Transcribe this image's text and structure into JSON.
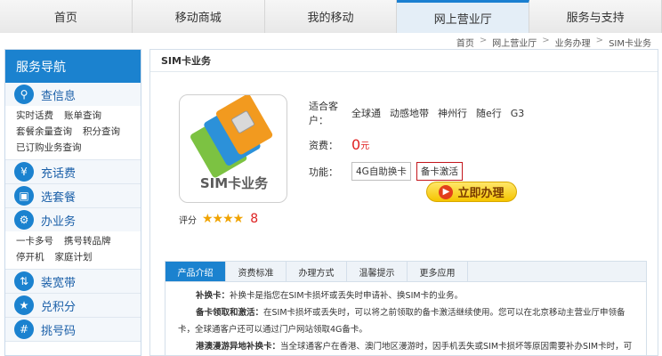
{
  "topnav": [
    "首页",
    "移动商城",
    "我的移动",
    "网上营业厅",
    "服务与支持"
  ],
  "breadcrumb": [
    "首页",
    "网上营业厅",
    "业务办理",
    "SIM卡业务"
  ],
  "sidebar": {
    "title": "服务导航",
    "sections": [
      {
        "title": "查信息",
        "icon": "search-icon",
        "links": [
          "实时话费",
          "账单查询",
          "套餐余量查询",
          "积分查询",
          "已订购业务查询"
        ]
      },
      {
        "title": "充话费",
        "icon": "recharge-icon",
        "links": []
      },
      {
        "title": "选套餐",
        "icon": "package-icon",
        "links": []
      },
      {
        "title": "办业务",
        "icon": "gear-icon",
        "links": [
          "一卡多号",
          "携号转品牌",
          "停开机",
          "家庭计划"
        ]
      },
      {
        "title": "装宽带",
        "icon": "broadband-icon",
        "links": []
      },
      {
        "title": "兑积分",
        "icon": "points-icon",
        "links": []
      },
      {
        "title": "挑号码",
        "icon": "number-icon",
        "links": []
      }
    ]
  },
  "main": {
    "title": "SIM卡业务",
    "product_image_text": "SIM卡业务",
    "rating_label": "评分",
    "rating_stars": 4,
    "rating_score": "8",
    "customers_label": "适合客户：",
    "customers": [
      "全球通",
      "动感地带",
      "神州行",
      "随e行",
      "G3"
    ],
    "price_label": "资费：",
    "price": "0",
    "price_unit": "元",
    "func_label": "功能：",
    "functions": [
      "4G自助换卡",
      "备卡激活"
    ],
    "apply_button": "立即办理",
    "tabs": [
      "产品介绍",
      "资费标准",
      "办理方式",
      "温馨提示",
      "更多应用"
    ],
    "desc": [
      {
        "bold": "补换卡：",
        "text": "补换卡是指您在SIM卡损坏或丢失时申请补、换SIM卡的业务。"
      },
      {
        "bold": "备卡领取和激活：",
        "text": "在SIM卡损坏或丢失时，可以将之前领取的备卡激活继续使用。您可以在北京移动主营业厅申领备卡，全球通客户还可以通过门户网站领取4G备卡。"
      },
      {
        "bold": "港澳漫游异地补换卡：",
        "text": "当全球通客户在香港、澳门地区漫游时，因手机丢失或SIM卡损坏等原因需要补办SIM卡时，可以"
      }
    ]
  }
}
